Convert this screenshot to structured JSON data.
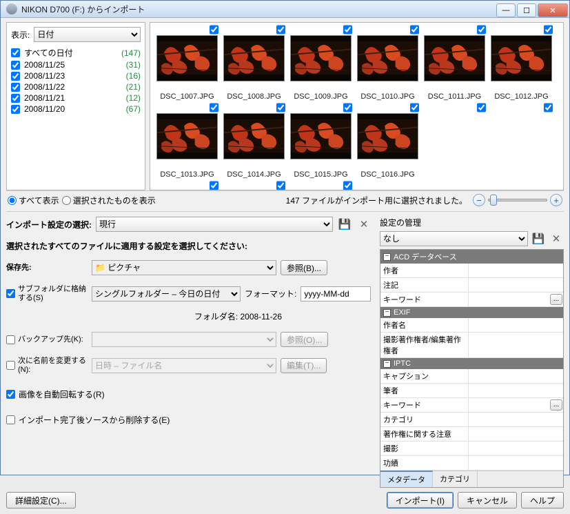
{
  "window": {
    "title": "NIKON D700 (F:) からインポート"
  },
  "display": {
    "label": "表示:",
    "selected": "日付"
  },
  "dates": [
    {
      "name": "すべての日付",
      "count": "(147)"
    },
    {
      "name": "2008/11/25",
      "count": "(31)"
    },
    {
      "name": "2008/11/23",
      "count": "(16)"
    },
    {
      "name": "2008/11/22",
      "count": "(21)"
    },
    {
      "name": "2008/11/21",
      "count": "(12)"
    },
    {
      "name": "2008/11/20",
      "count": "(67)"
    }
  ],
  "thumbs": [
    "DSC_1007.JPG",
    "DSC_1008.JPG",
    "DSC_1009.JPG",
    "DSC_1010.JPG",
    "DSC_1011.JPG",
    "DSC_1012.JPG",
    "DSC_1013.JPG",
    "DSC_1014.JPG",
    "DSC_1015.JPG",
    "DSC_1016.JPG"
  ],
  "status": {
    "show_all": "すべて表示",
    "show_selected": "選択されたものを表示",
    "message": "147 ファイルがインポート用に選択されました。"
  },
  "import_settings": {
    "label": "インポート設定の選択:",
    "value": "現行"
  },
  "settings_mgmt": {
    "label": "設定の管理",
    "value": "なし"
  },
  "apply_section_title": "選択されたすべてのファイルに適用する設定を選択してください:",
  "dest": {
    "label": "保存先:",
    "value": "ピクチャ",
    "browse": "参照(B)..."
  },
  "subfolder": {
    "label": "サブフォルダに格納する(S)",
    "value": "シングルフォルダー – 今日の日付",
    "format_label": "フォーマット:",
    "format_value": "yyyy-MM-dd"
  },
  "folder_name": {
    "label": "フォルダ名:",
    "value": "2008-11-26"
  },
  "backup": {
    "label": "バックアップ先(K):",
    "browse": "参照(O)..."
  },
  "rename": {
    "label": "次に名前を変更する(N):",
    "value": "日時 – ファイル名",
    "edit": "編集(T)..."
  },
  "auto_rotate": "画像を自動回転する(R)",
  "delete_after": "インポート完了後ソースから削除する(E)",
  "advanced": "詳細設定(C)...",
  "footer": {
    "import": "インポート(I)",
    "cancel": "キャンセル",
    "help": "ヘルプ"
  },
  "meta": {
    "sections": {
      "acd": "ACD データベース",
      "exif": "EXIF",
      "iptc": "IPTC"
    },
    "fields": {
      "author": "作者",
      "notes": "注記",
      "keyword": "キーワード",
      "creator": "作者名",
      "copyright": "撮影著作権者/編集著作権者",
      "caption": "キャプション",
      "writer": "筆者",
      "keyword2": "キーワード",
      "category": "カテゴリ",
      "copyright_notice": "著作権に関する注意",
      "shoot": "撮影",
      "credit": "功績"
    },
    "tabs": {
      "metadata": "メタデータ",
      "category": "カテゴリ"
    }
  }
}
